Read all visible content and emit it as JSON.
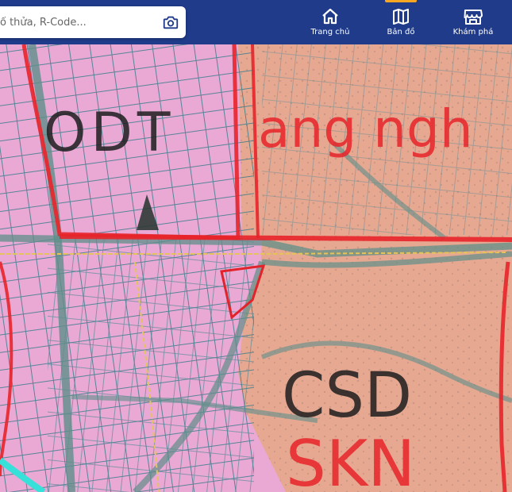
{
  "search": {
    "placeholder": "ố thửa, R-Code..."
  },
  "nav": [
    {
      "label": "Trang chủ",
      "icon": "home-icon"
    },
    {
      "label": "Bản đồ",
      "icon": "map-icon",
      "active": true
    },
    {
      "label": "Khám phá",
      "icon": "store-icon"
    }
  ],
  "map": {
    "labels": {
      "odt": "ODT",
      "lang_nghe": "ang ngh",
      "csd": "CSD",
      "skn": "SKN"
    },
    "colors": {
      "residential_pink": "#e9a9d4",
      "land_salmon": "#e8a88f",
      "boundary_red": "#e8242a",
      "parcel_lines": "#3d7e8c",
      "road_teal": "#5f8f8a",
      "highlight_parcel": "#e2232b",
      "water_cyan": "#37e0d8"
    }
  }
}
